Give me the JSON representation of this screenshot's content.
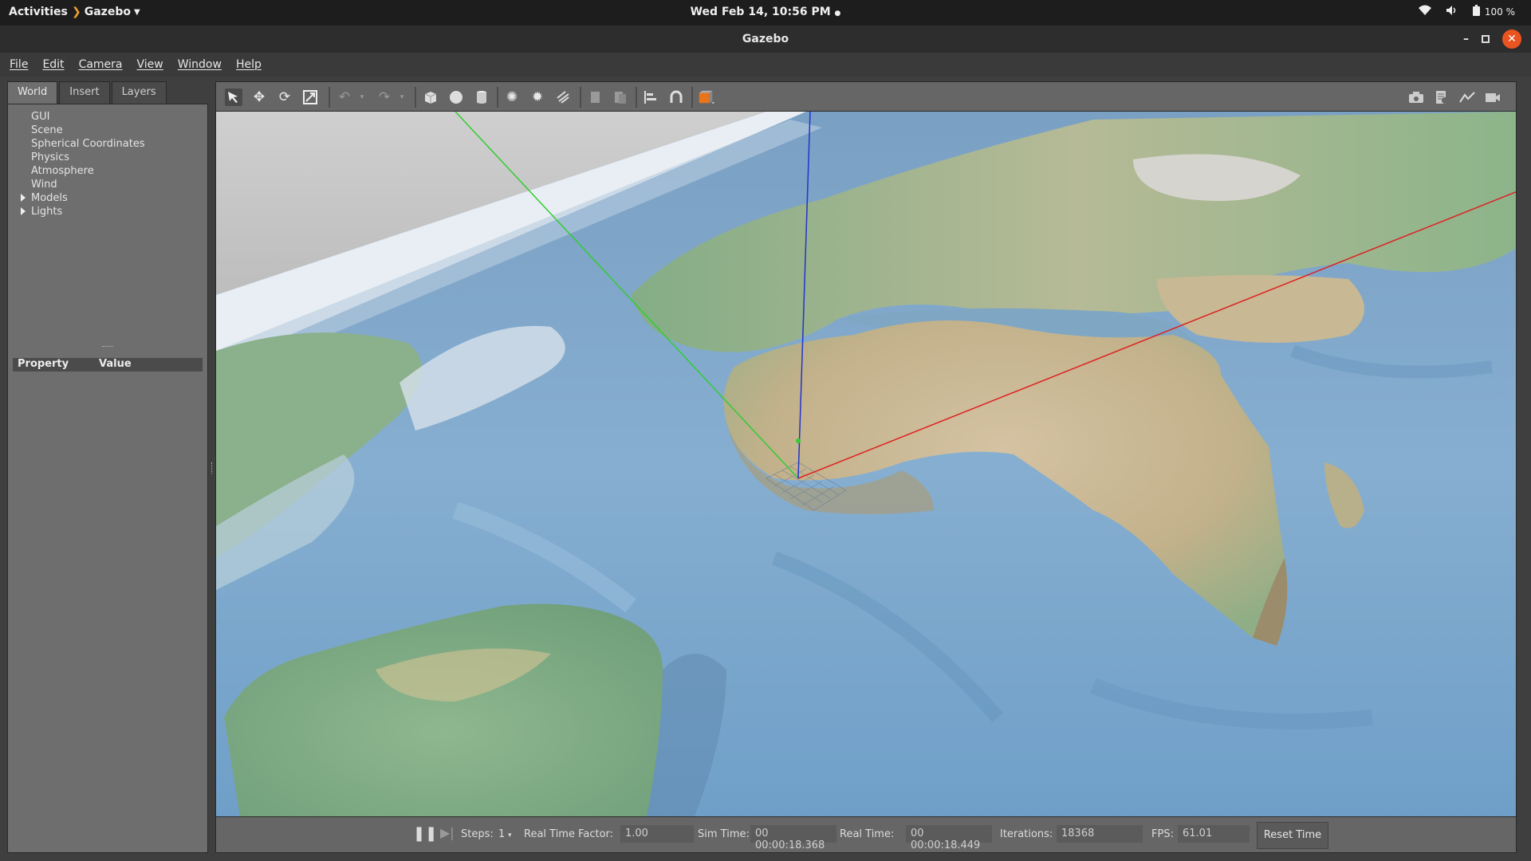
{
  "topbar": {
    "activities": "Activities",
    "app_name": "Gazebo",
    "clock": "Wed Feb 14, 10:56 PM",
    "battery": "100 %"
  },
  "window": {
    "title": "Gazebo"
  },
  "menu": [
    "File",
    "Edit",
    "Camera",
    "View",
    "Window",
    "Help"
  ],
  "left_panel": {
    "tabs": [
      "World",
      "Insert",
      "Layers"
    ],
    "active_tab": "World",
    "tree": [
      {
        "label": "GUI",
        "expandable": false
      },
      {
        "label": "Scene",
        "expandable": false
      },
      {
        "label": "Spherical Coordinates",
        "expandable": false
      },
      {
        "label": "Physics",
        "expandable": false
      },
      {
        "label": "Atmosphere",
        "expandable": false
      },
      {
        "label": "Wind",
        "expandable": false
      },
      {
        "label": "Models",
        "expandable": true
      },
      {
        "label": "Lights",
        "expandable": true
      }
    ],
    "property_header": "Property",
    "value_header": "Value"
  },
  "toolbar": {
    "icons": [
      "select-arrow-icon",
      "translate-icon",
      "rotate-icon",
      "scale-icon",
      "undo-icon",
      "redo-icon",
      "box-icon",
      "sphere-icon",
      "cylinder-icon",
      "point-light-icon",
      "spot-light-icon",
      "directional-light-icon",
      "copy-icon",
      "paste-icon",
      "align-icon",
      "snap-icon",
      "view-angle-icon"
    ],
    "right_icons": [
      "screenshot-icon",
      "log-icon",
      "plot-icon",
      "record-video-icon"
    ]
  },
  "status": {
    "steps_label": "Steps:",
    "steps_value": "1",
    "rtf_label": "Real Time Factor:",
    "rtf_value": "1.00",
    "sim_time_label": "Sim Time:",
    "sim_time_value": "00 00:00:18.368",
    "real_time_label": "Real Time:",
    "real_time_value": "00 00:00:18.449",
    "iterations_label": "Iterations:",
    "iterations_value": "18368",
    "fps_label": "FPS:",
    "fps_value": "61.01",
    "reset_label": "Reset Time"
  },
  "colors": {
    "ocean": "#7fa7c4",
    "land_green": "#7fae8a",
    "land_tan": "#c9b696",
    "axis_x": "#e03030",
    "axis_y": "#30c030",
    "axis_z": "#2030d0",
    "accent": "#e95420"
  }
}
